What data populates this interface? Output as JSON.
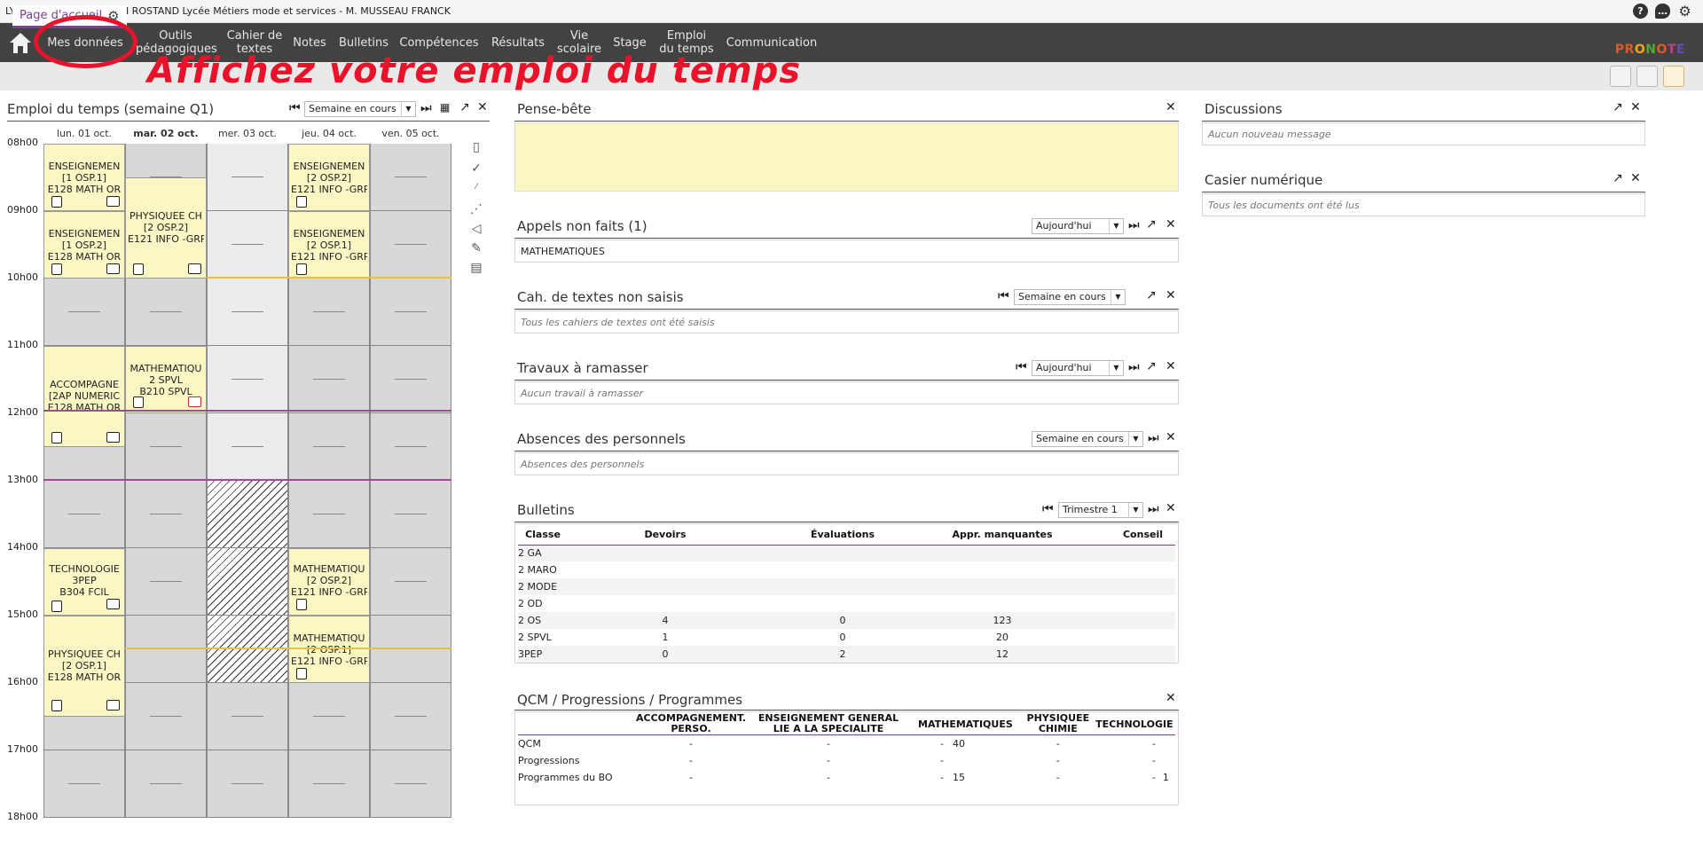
{
  "window": {
    "title": "LYCEE DES METIERS JEAN ROSTAND Lycée Métiers mode et services - M. MUSSEAU FRANCK",
    "icons": [
      "help-icon",
      "chat-icon",
      "gear-icon"
    ]
  },
  "nav": {
    "items": [
      {
        "label": "Mes données"
      },
      {
        "label": "Outils pédagogiques"
      },
      {
        "label": "Cahier de textes"
      },
      {
        "label": "Notes"
      },
      {
        "label": "Bulletins"
      },
      {
        "label": "Compétences"
      },
      {
        "label": "Résultats"
      },
      {
        "label": "Vie scolaire"
      },
      {
        "label": "Stage"
      },
      {
        "label": "Emploi du temps"
      },
      {
        "label": "Communication"
      }
    ],
    "logo": "PRONOTE",
    "accent": "#7b3f99"
  },
  "subbar": {
    "page_tab": "Page d'accueil",
    "annotation": "Affichez votre emploi du temps"
  },
  "timetable": {
    "title": "Emploi du temps (semaine Q1)",
    "week_select": "Semaine en cours",
    "days": [
      "lun. 01 oct.",
      "mar. 02 oct.",
      "mer. 03 oct.",
      "jeu. 04 oct.",
      "ven. 05 oct."
    ],
    "hours": [
      "08h00",
      "09h00",
      "10h00",
      "11h00",
      "12h00",
      "13h00",
      "14h00",
      "15h00",
      "16h00",
      "17h00",
      "18h00"
    ],
    "courses": [
      {
        "lines": [
          "ENSEIGNEMEN",
          "[1 OSP.1]",
          "E128 MATH OR"
        ]
      },
      {
        "lines": [
          "ENSEIGNEMEN",
          "[1 OSP.2]",
          "E128 MATH OR"
        ]
      },
      {
        "lines": [
          "ACCOMPAGNE",
          "[2AP NUMERIC",
          "E128 MATH OR"
        ]
      },
      {
        "lines": [
          "TECHNOLOGIE",
          "3PEP",
          "B304 FCIL"
        ]
      },
      {
        "lines": [
          "PHYSIQUEE CH",
          "[2 OSP.1]",
          "E128 MATH OR"
        ]
      },
      {
        "lines": [
          "PHYSIQUEE CH",
          "[2 OSP.2]",
          "E121 INFO -GRP"
        ]
      },
      {
        "lines": [
          "MATHEMATIQU",
          "2 SPVL",
          "B210 SPVL"
        ]
      },
      {
        "lines": [
          "ENSEIGNEMEN",
          "[2 OSP.2]",
          "E121 INFO -GRP"
        ]
      },
      {
        "lines": [
          "ENSEIGNEMEN",
          "[2 OSP.1]",
          "E121 INFO -GRP"
        ]
      },
      {
        "lines": [
          "MATHEMATIQU",
          "[2 OSP.2]",
          "E121 INFO -GRP"
        ]
      },
      {
        "lines": [
          "MATHEMATIQU",
          "[2 OSP.1]",
          "E121 INFO -GRP"
        ]
      }
    ]
  },
  "pense_bete": {
    "title": "Pense-bête",
    "color": "#fbf7c5"
  },
  "appels": {
    "title": "Appels non faits (1)",
    "select": "Aujourd'hui",
    "item": "MATHEMATIQUES"
  },
  "cahiers": {
    "title": "Cah. de textes non saisis",
    "select": "Semaine en cours",
    "message": "Tous les cahiers de textes ont été saisis"
  },
  "travaux": {
    "title": "Travaux à ramasser",
    "select": "Aujourd'hui",
    "message": "Aucun travail à ramasser"
  },
  "absences": {
    "title": "Absences des personnels",
    "select": "Semaine en cours",
    "message": "Absences des personnels"
  },
  "bulletins": {
    "title": "Bulletins",
    "select": "Trimestre 1",
    "headers": [
      "Classe",
      "Devoirs",
      "Évaluations",
      "Appr. manquantes",
      "Conseil"
    ],
    "rows": [
      [
        "2 GA",
        "",
        "",
        "",
        ""
      ],
      [
        "2 MARO",
        "",
        "",
        "",
        ""
      ],
      [
        "2 MODE",
        "",
        "",
        "",
        ""
      ],
      [
        "2 OD",
        "",
        "",
        "",
        ""
      ],
      [
        "2 OS",
        "4",
        "0",
        "123",
        ""
      ],
      [
        "2 SPVL",
        "1",
        "0",
        "20",
        ""
      ],
      [
        "3PEP",
        "0",
        "2",
        "12",
        ""
      ]
    ]
  },
  "qcm": {
    "title": "QCM / Progressions / Programmes",
    "headers": [
      "",
      "ACCOMPAGNEMENT. PERSO.",
      "ENSEIGNEMENT GENERAL LIE A LA SPECIALITE",
      "MATHEMATIQUES",
      "PHYSIQUEE CHIMIE",
      "TECHNOLOGIE"
    ],
    "rows": [
      [
        "QCM",
        "-",
        "-",
        "-",
        "40",
        "-",
        "-",
        ""
      ],
      [
        "Progressions",
        "-",
        "-",
        "-",
        "",
        "-",
        "-",
        ""
      ],
      [
        "Programmes du BO",
        "-",
        "-",
        "-",
        "15",
        "-",
        "-",
        "1"
      ]
    ]
  },
  "discussions": {
    "title": "Discussions",
    "message": "Aucun nouveau message"
  },
  "casier": {
    "title": "Casier numérique",
    "message": "Tous les documents ont été lus"
  }
}
